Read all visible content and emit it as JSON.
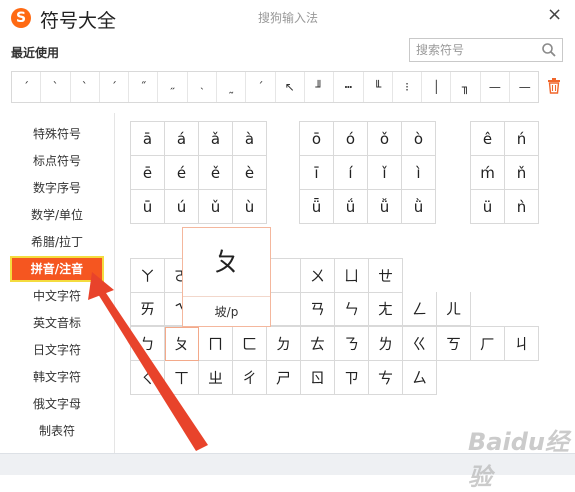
{
  "app": {
    "title": "符号大全",
    "caption": "搜狗输入法",
    "logo": "S",
    "close": "×"
  },
  "recent": {
    "label": "最近使用",
    "symbols": [
      "ˊ",
      "ˋ",
      "ˋ",
      "ˊ",
      "˝",
      "˶",
      "˴",
      "˷",
      "ˊ",
      "↖",
      "╜",
      "┅",
      "╙",
      "⁝",
      "│",
      "╖",
      "—",
      "—"
    ]
  },
  "search": {
    "placeholder": "搜索符号"
  },
  "sidebar": {
    "items": [
      {
        "label": "特殊符号"
      },
      {
        "label": "标点符号"
      },
      {
        "label": "数字序号"
      },
      {
        "label": "数学/单位"
      },
      {
        "label": "希腊/拉丁"
      },
      {
        "label": "拼音/注音"
      },
      {
        "label": "中文字符"
      },
      {
        "label": "英文音标"
      },
      {
        "label": "日文字符"
      },
      {
        "label": "韩文字符"
      },
      {
        "label": "俄文字母"
      },
      {
        "label": "制表符"
      }
    ],
    "active_index": 5
  },
  "pinyin": {
    "group_a": [
      "ā",
      "á",
      "ǎ",
      "à",
      "ē",
      "é",
      "ě",
      "è",
      "ū",
      "ú",
      "ǔ",
      "ù"
    ],
    "group_o": [
      "ō",
      "ó",
      "ǒ",
      "ò",
      "ī",
      "í",
      "ǐ",
      "ì",
      "ǖ",
      "ǘ",
      "ǚ",
      "ǜ"
    ],
    "group_e": [
      "ê",
      "ń",
      "ḿ",
      "ň",
      "ü",
      "ǹ"
    ]
  },
  "zhuyin": {
    "row1": [
      "ㄚ",
      "ㄛ",
      "ㄜ",
      "ㄝ",
      "ㄞ",
      "ㄟ",
      "ㄠ",
      "ㄡ",
      "ㄢ",
      "ㄣ",
      "ㄤ",
      "ㄥ",
      "ㄦ"
    ],
    "row1_visible": [
      "ㄚ",
      "ㄛ",
      "",
      "",
      "",
      "ㄨ",
      "ㄩ",
      "ㄝ"
    ],
    "row2": [
      "ㄞ",
      "ㄟ",
      "",
      "",
      "",
      "ㄢ",
      "ㄣ",
      "ㄤ",
      "ㄥ",
      "ㄦ"
    ],
    "row3": [
      "ㄅ",
      "ㄆ",
      "ㄇ",
      "ㄈ",
      "ㄉ",
      "ㄊ",
      "ㄋ",
      "ㄌ",
      "ㄍ",
      "ㄎ",
      "ㄏ",
      "ㄐ"
    ],
    "row4": [
      "ㄑ",
      "ㄒ",
      "ㄓ",
      "ㄔ",
      "ㄕ",
      "ㄖ",
      "ㄗ",
      "ㄘ",
      "ㄙ"
    ]
  },
  "tooltip": {
    "symbol": "ㄆ",
    "hint": "坡/p"
  },
  "watermark": "Baidu经验",
  "colors": {
    "accent": "#f55620",
    "active_border": "#f4dc3f",
    "arrow": "#e8432b"
  }
}
